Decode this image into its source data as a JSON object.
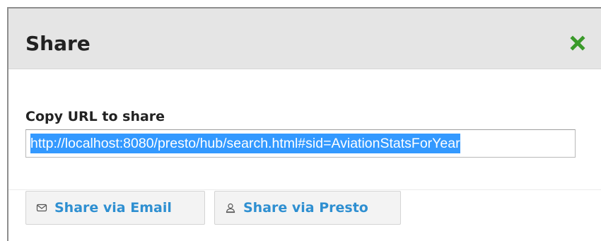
{
  "dialog": {
    "title": "Share",
    "close_icon": "close-x-icon",
    "close_color": "#3a9a2a"
  },
  "share": {
    "label": "Copy URL to share",
    "url": "http://localhost:8080/presto/hub/search.html#sid=AviationStatsForYear"
  },
  "actions": {
    "email_label": "Share via Email",
    "email_icon": "envelope-icon",
    "presto_label": "Share via Presto",
    "presto_icon": "user-icon",
    "link_color": "#2e8fd1"
  }
}
